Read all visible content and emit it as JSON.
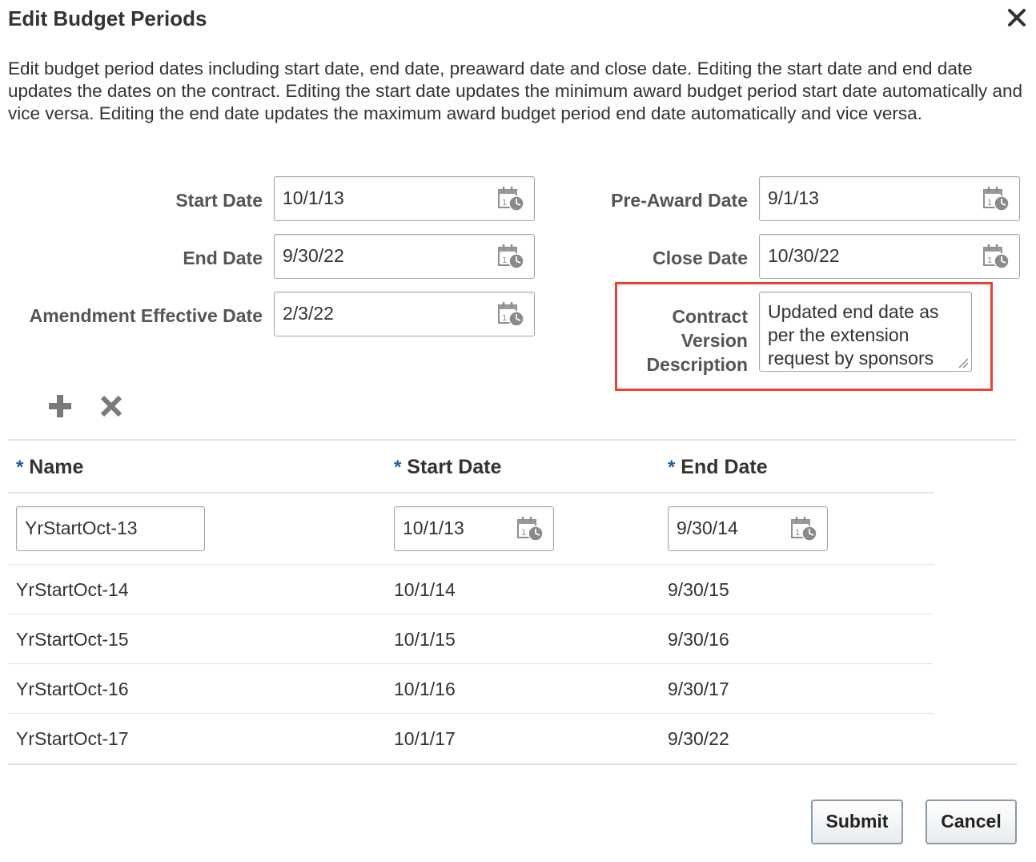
{
  "dialog": {
    "title": "Edit Budget Periods",
    "description": "Edit budget period dates including start date, end date, preaward date and close date. Editing the start date and end date updates the dates on the contract. Editing the start date updates the minimum award budget period start date automatically and vice versa. Editing the end date updates the maximum award budget period end date automatically and vice versa."
  },
  "form": {
    "start_date": {
      "label": "Start Date",
      "value": "10/1/13"
    },
    "end_date": {
      "label": "End Date",
      "value": "9/30/22"
    },
    "amendment_effective_date": {
      "label": "Amendment Effective Date",
      "value": "2/3/22"
    },
    "pre_award_date": {
      "label": "Pre-Award Date",
      "value": "9/1/13"
    },
    "close_date": {
      "label": "Close Date",
      "value": "10/30/22"
    },
    "contract_version_description": {
      "label_lines": [
        "Contract",
        "Version",
        "Description"
      ],
      "value": "Updated end date as per the extension request by sponsors"
    }
  },
  "table": {
    "required_marker": "*",
    "columns": [
      "Name",
      "Start Date",
      "End Date"
    ],
    "editable_row": {
      "name": "YrStartOct-13",
      "start": "10/1/13",
      "end": "9/30/14"
    },
    "rows": [
      {
        "name": "YrStartOct-14",
        "start": "10/1/14",
        "end": "9/30/15"
      },
      {
        "name": "YrStartOct-15",
        "start": "10/1/15",
        "end": "9/30/16"
      },
      {
        "name": "YrStartOct-16",
        "start": "10/1/16",
        "end": "9/30/17"
      },
      {
        "name": "YrStartOct-17",
        "start": "10/1/17",
        "end": "9/30/22"
      }
    ]
  },
  "buttons": {
    "submit": "Submit",
    "cancel": "Cancel"
  },
  "colors": {
    "highlight": "#e8432f",
    "required": "#1f5f9e",
    "icon_gray": "#7a7a7a"
  }
}
